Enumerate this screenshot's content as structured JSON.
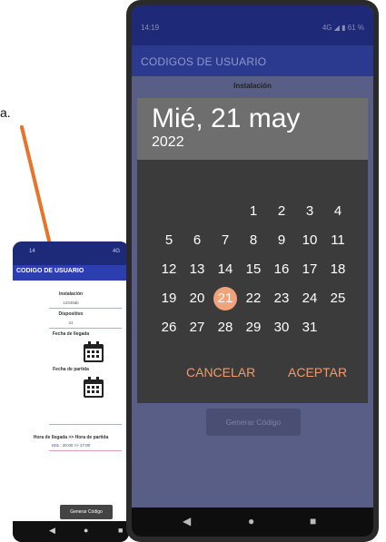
{
  "annotation": {
    "text": "a."
  },
  "small_phone": {
    "status_time": "14",
    "status_right": "4G",
    "title": "CODIGO DE USUARIO",
    "instalacion_label": "Instalación",
    "instalacion_value": "123456b",
    "dispositivo_label": "Dispositivo",
    "dispositivo_value": "31",
    "fecha_llegada_label": "Fecha de llegada",
    "fecha_partida_label": "Fecha de partida",
    "hora_label": "Hora de llegada >> Hora de partida",
    "hora_value": "H31 : 20:00 >> 17:00",
    "button": "Generar Código"
  },
  "big_phone": {
    "status_time": "14:19",
    "status_right": "4G ◢ ▮ 61 %",
    "app_title": "CODIGOS DE USUARIO",
    "instalacion_label": "Instalación",
    "generate_button": "Generar Código",
    "dialog": {
      "date_header": "Mié, 21 may",
      "year": "2022",
      "days": [
        "1",
        "2",
        "3",
        "4",
        "5",
        "6",
        "7",
        "8",
        "9",
        "10",
        "11",
        "12",
        "13",
        "14",
        "15",
        "16",
        "17",
        "18",
        "19",
        "20",
        "21",
        "22",
        "23",
        "24",
        "25",
        "26",
        "27",
        "28",
        "29",
        "30",
        "31"
      ],
      "selected_day": "21",
      "cancel": "CANCELAR",
      "accept": "ACEPTAR"
    },
    "nav": {
      "back": "◀",
      "home": "●",
      "recent": "■"
    }
  },
  "colors": {
    "accent": "#f2a37a",
    "appbar": "#2b3a8e",
    "arrow": "#e8732a"
  }
}
